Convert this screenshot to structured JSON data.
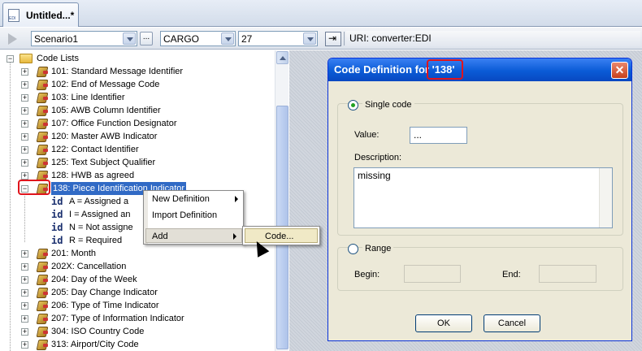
{
  "tab": {
    "title": "Untitled...*"
  },
  "toolbar": {
    "scenario": "Scenario1",
    "dots": "...",
    "message": "CARGO",
    "version": "27",
    "uri": "URI: converter:EDI"
  },
  "tree": {
    "root": "Code Lists",
    "items": [
      "101: Standard Message Identifier",
      "102: End of Message Code",
      "103: Line Identifier",
      "105: AWB Column Identifier",
      "107: Office Function Designator",
      "120: Master AWB Indicator",
      "122: Contact Identifier",
      "125: Text Subject Qualifier",
      "128: HWB as agreed",
      "138: Piece Identification Indicator"
    ],
    "children": [
      {
        "tag": "id",
        "label": "A = Assigned a"
      },
      {
        "tag": "id",
        "label": "I = Assigned an"
      },
      {
        "tag": "id",
        "label": "N = Not assigne"
      },
      {
        "tag": "id",
        "label": "R = Required"
      }
    ],
    "items_after": [
      "201: Month",
      "202X: Cancellation",
      "204: Day of the Week",
      "205: Day Change Indicator",
      "206: Type of Time Indicator",
      "207: Type of Information Indicator",
      "304: ISO Country Code",
      "313: Airport/City Code"
    ]
  },
  "context_menu": {
    "items": [
      "New Definition",
      "Import Definition",
      "Add"
    ],
    "submenu": "Code..."
  },
  "dialog": {
    "title_prefix": "Code Definition for ",
    "title_code": "'138'",
    "close": "✕",
    "single_code": "Single code",
    "value_label": "Value:",
    "value": "...",
    "description_label": "Description:",
    "description": "missing",
    "range": "Range",
    "begin_label": "Begin:",
    "end_label": "End:",
    "ok": "OK",
    "cancel": "Cancel"
  }
}
